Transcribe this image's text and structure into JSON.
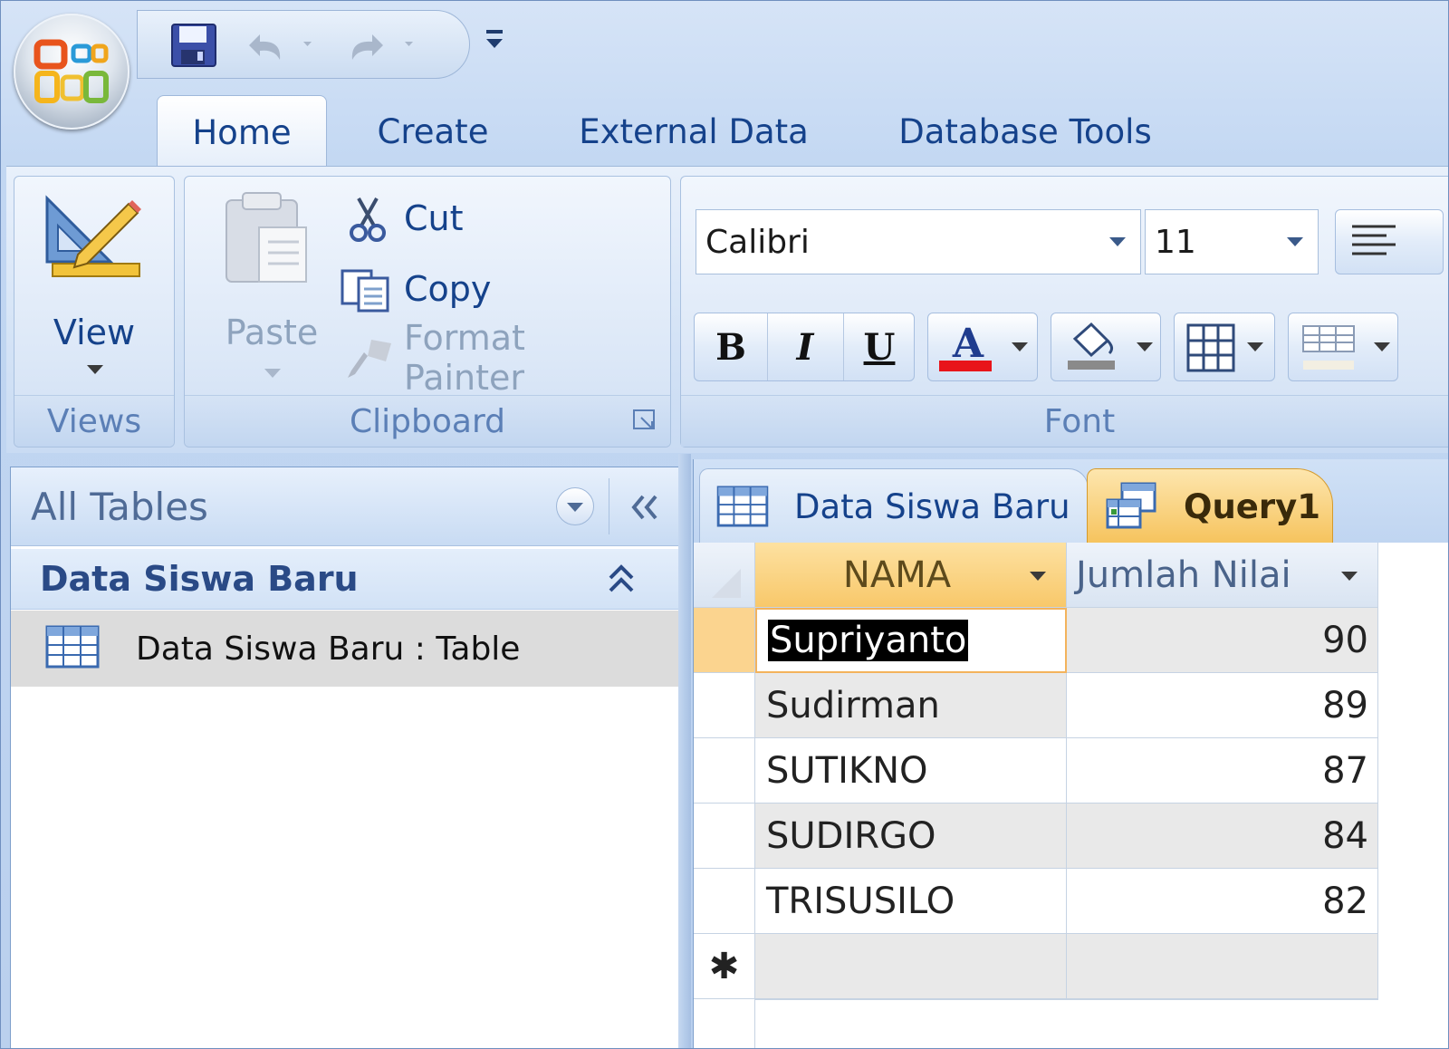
{
  "quick_access": {
    "save_icon": "save-icon",
    "undo_icon": "undo-icon",
    "redo_icon": "redo-icon",
    "customize_icon": "customize-qat-icon"
  },
  "tabs": [
    {
      "label": "Home",
      "active": true
    },
    {
      "label": "Create"
    },
    {
      "label": "External Data"
    },
    {
      "label": "Database Tools"
    }
  ],
  "ribbon": {
    "views": {
      "label": "Views",
      "view_label": "View"
    },
    "clipboard": {
      "label": "Clipboard",
      "paste": "Paste",
      "cut": "Cut",
      "copy": "Copy",
      "format_painter": "Format Painter"
    },
    "font": {
      "label": "Font",
      "font_name": "Calibri",
      "font_size": "11",
      "bold": "B",
      "italic": "I",
      "underline": "U",
      "font_color": "A",
      "font_color_hex": "#e8141a"
    }
  },
  "nav": {
    "title": "All Tables",
    "group_title": "Data Siswa Baru",
    "items": [
      {
        "label": "Data Siswa Baru : Table"
      }
    ]
  },
  "doc_tabs": [
    {
      "label": "Data Siswa Baru",
      "active": false
    },
    {
      "label": "Query1",
      "active": true
    }
  ],
  "datasheet": {
    "columns": [
      "NAMA",
      "Jumlah Nilai"
    ],
    "rows": [
      {
        "nama": "Supriyanto",
        "nilai": "90"
      },
      {
        "nama": "Sudirman",
        "nilai": "89"
      },
      {
        "nama": "SUTIKNO",
        "nilai": "87"
      },
      {
        "nama": "SUDIRGO",
        "nilai": "84"
      },
      {
        "nama": "TRISUSILO",
        "nilai": "82"
      }
    ],
    "new_row_marker": "✱"
  }
}
